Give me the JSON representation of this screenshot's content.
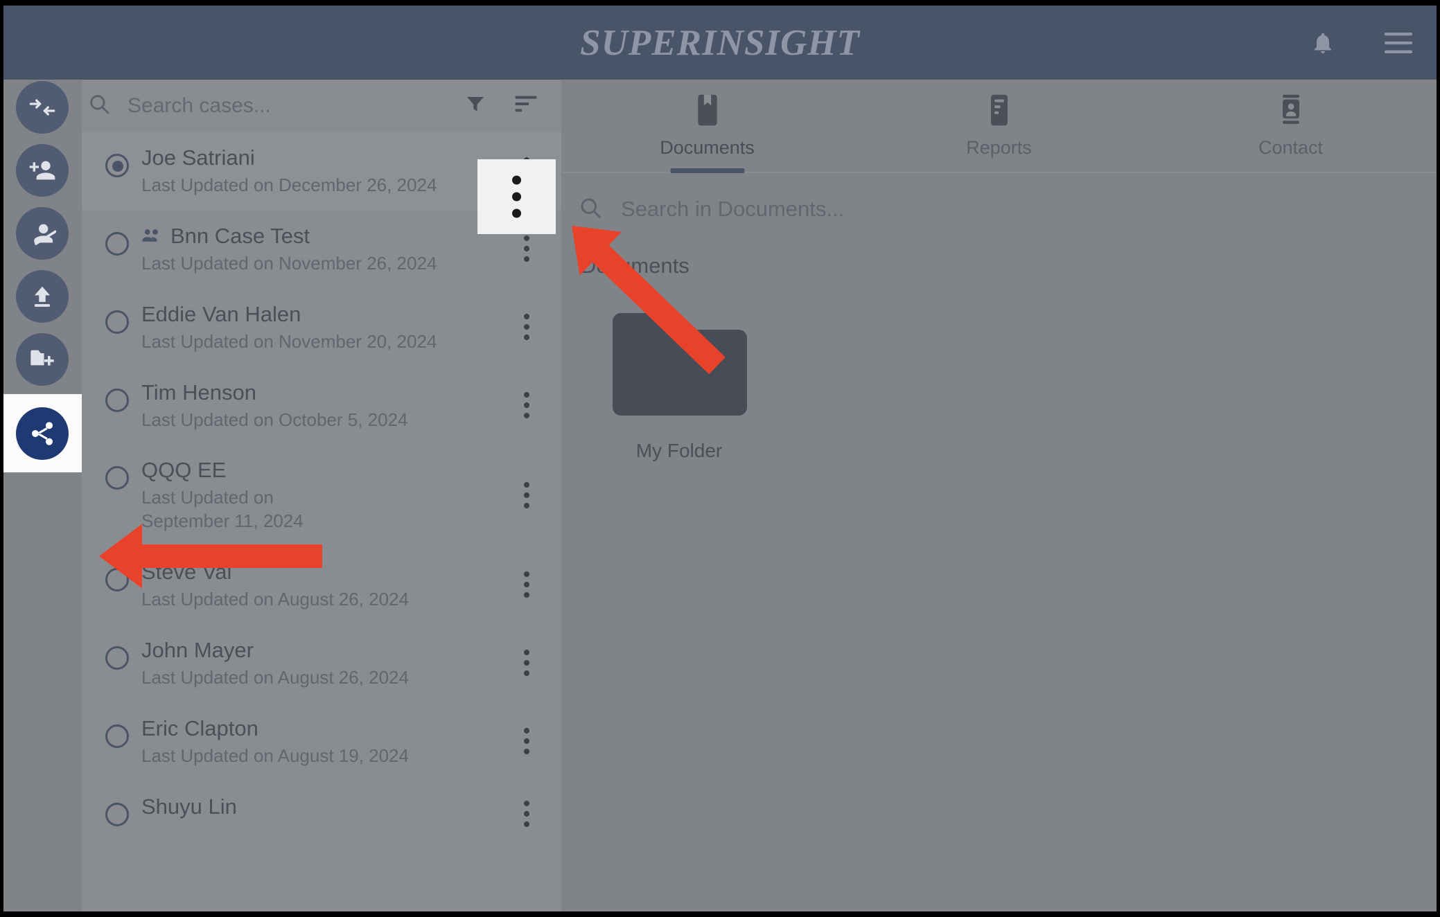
{
  "app": {
    "brand": "SUPERINSIGHT",
    "accent_header": "#4a5468",
    "accent_share": "#1f3a73",
    "annotation_color": "#e8432a",
    "overlay_color": "#808388"
  },
  "appbar": {
    "notifications_icon": "bell-icon",
    "menu_icon": "hamburger-menu-icon"
  },
  "rail": {
    "items": [
      {
        "name": "transfer-case-button",
        "icon": "transfer-arrows-icon"
      },
      {
        "name": "add-person-button",
        "icon": "person-add-icon"
      },
      {
        "name": "remove-person-button",
        "icon": "person-off-icon"
      },
      {
        "name": "upload-button",
        "icon": "upload-icon"
      },
      {
        "name": "new-folder-button",
        "icon": "folder-add-icon"
      },
      {
        "name": "share-button",
        "icon": "share-icon",
        "highlighted": true
      }
    ]
  },
  "case_list": {
    "search": {
      "placeholder": "Search cases...",
      "value": ""
    },
    "filter_icon": "filter-funnel-icon",
    "sort_icon": "sort-icon",
    "cases": [
      {
        "name": "Joe Satriani",
        "date": "Last Updated on December 26, 2024",
        "selected": true,
        "group": false
      },
      {
        "name": "Bnn Case Test",
        "date": "Last Updated on November 26, 2024",
        "selected": false,
        "group": true
      },
      {
        "name": "Eddie Van Halen",
        "date": "Last Updated on November 20, 2024",
        "selected": false,
        "group": false
      },
      {
        "name": "Tim Henson",
        "date": "Last Updated on October 5, 2024",
        "selected": false,
        "group": false
      },
      {
        "name": "QQQ EE",
        "date": "Last Updated on September 11, 2024",
        "selected": false,
        "group": false
      },
      {
        "name": "Steve Vai",
        "date": "Last Updated on August 26, 2024",
        "selected": false,
        "group": false
      },
      {
        "name": "John Mayer",
        "date": "Last Updated on August 26, 2024",
        "selected": false,
        "group": false
      },
      {
        "name": "Eric Clapton",
        "date": "Last Updated on August 19, 2024",
        "selected": false,
        "group": false
      },
      {
        "name": "Shuyu Lin",
        "date": "",
        "selected": false,
        "group": false
      }
    ]
  },
  "main": {
    "tabs": [
      {
        "label": "Documents",
        "icon": "bookmark-icon",
        "active": true
      },
      {
        "label": "Reports",
        "icon": "report-lines-icon",
        "active": false
      },
      {
        "label": "Contact",
        "icon": "contact-card-icon",
        "active": false
      }
    ],
    "search": {
      "placeholder": "Search in Documents...",
      "value": ""
    },
    "section_title": "Documents",
    "folders": [
      {
        "label": "My Folder",
        "icon": "folder-icon"
      }
    ]
  }
}
